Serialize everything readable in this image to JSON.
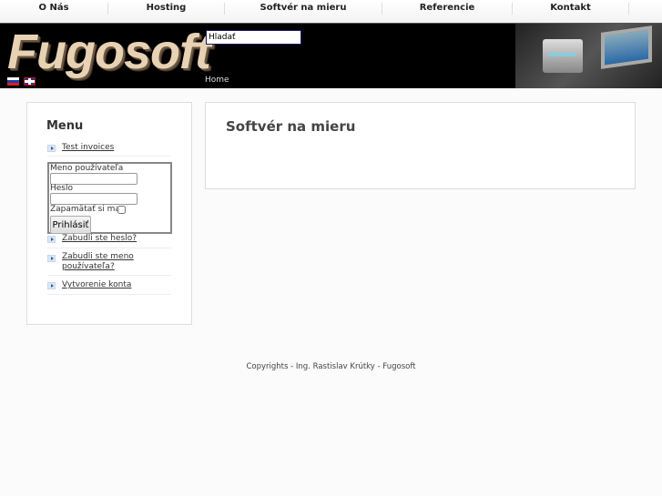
{
  "nav": {
    "items": [
      {
        "label": "O Nás"
      },
      {
        "label": "Hosting"
      },
      {
        "label": "Softvér na mieru"
      },
      {
        "label": "Referencie"
      },
      {
        "label": "Kontakt"
      }
    ]
  },
  "header": {
    "logo": "Fugosoft",
    "search_value": "Hladať",
    "breadcrumb": "Home",
    "languages": [
      "Slovenčina",
      "English"
    ]
  },
  "sidebar": {
    "title": "Menu",
    "items": [
      {
        "label": "Test invoices"
      }
    ],
    "login": {
      "username_label": "Meno používateľa",
      "password_label": "Heslo",
      "remember_label": "Zapamätať si ma",
      "submit_label": "Prihlásiť"
    },
    "links": [
      {
        "label": "Zabudli ste heslo?"
      },
      {
        "label": "Zabudli ste meno používateľa?"
      },
      {
        "label": "Vytvorenie konta"
      }
    ]
  },
  "content": {
    "title": "Softvér na mieru"
  },
  "footer": {
    "text": "Copyrights - Ing. Rastislav Krútky - Fugosoft"
  }
}
